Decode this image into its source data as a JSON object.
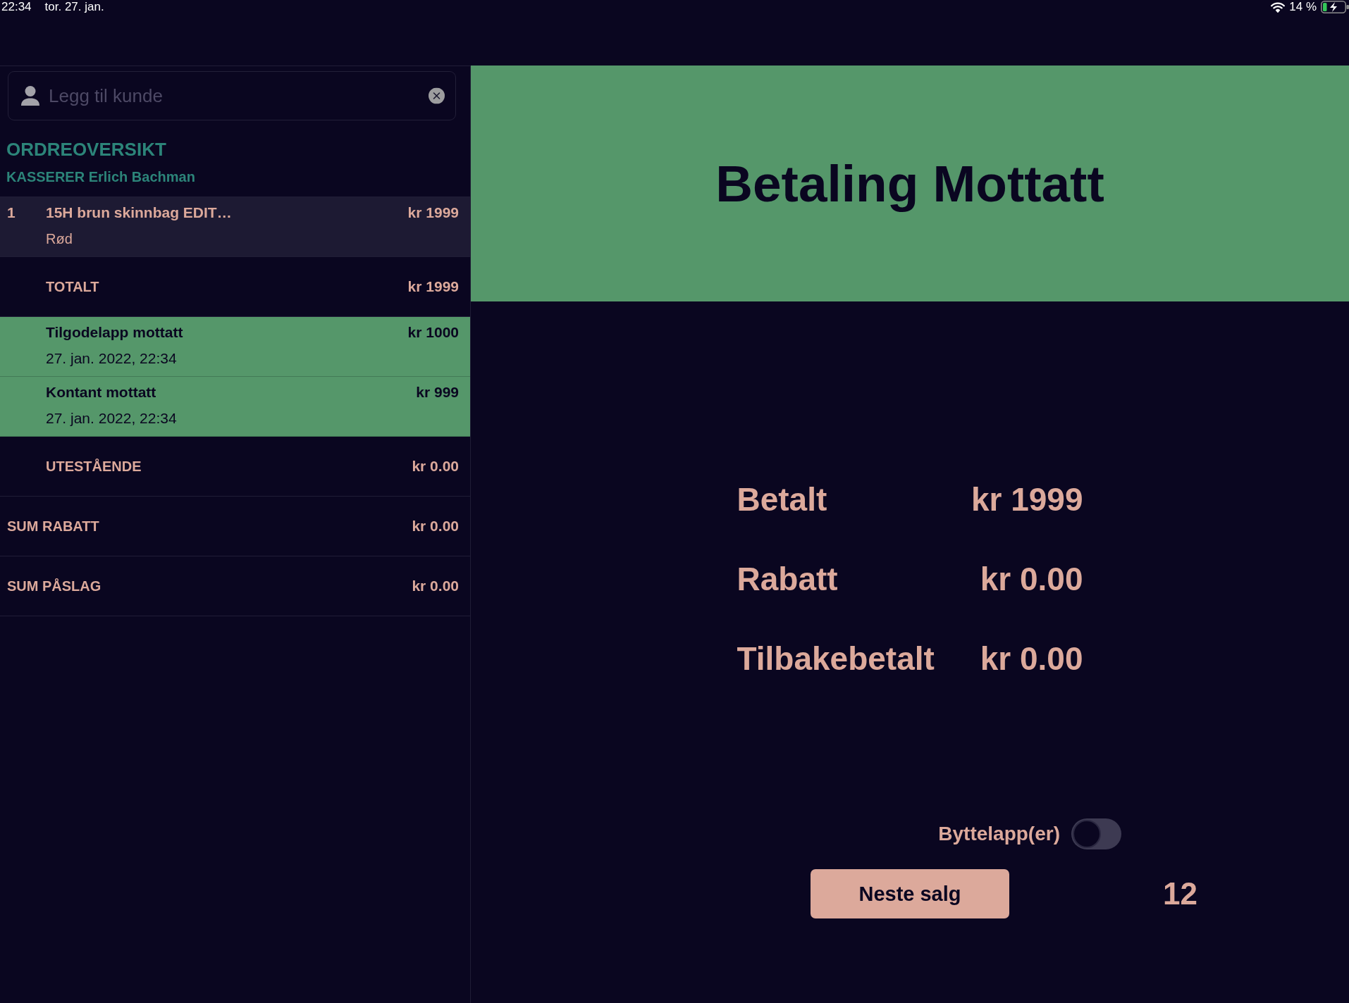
{
  "status_bar": {
    "time": "22:34",
    "date": "tor. 27. jan.",
    "battery": "14 %"
  },
  "customer_field": {
    "placeholder": "Legg til kunde"
  },
  "order_overview": {
    "title": "ORDREOVERSIKT",
    "cashier": "KASSERER Erlich Bachman",
    "rows": [
      {
        "kind": "item",
        "quantity": "1",
        "name": "15H brun skinnbag EDIT…",
        "variant": "Rød",
        "amount": "kr 1999"
      },
      {
        "kind": "total",
        "label": "TOTALT",
        "amount": "kr 1999"
      },
      {
        "kind": "payment",
        "label": "Tilgodelapp mottatt",
        "time": "27. jan. 2022, 22:34",
        "amount": "kr 1000"
      },
      {
        "kind": "payment",
        "label": "Kontant mottatt",
        "time": "27. jan. 2022, 22:34",
        "amount": "kr 999"
      },
      {
        "kind": "total",
        "label": "UTESTÅENDE",
        "amount": "kr 0.00"
      },
      {
        "kind": "summary",
        "label": "SUM RABATT",
        "amount": "kr 0.00"
      },
      {
        "kind": "summary",
        "label": "SUM PÅSLAG",
        "amount": "kr 0.00"
      }
    ]
  },
  "payment_panel": {
    "title": "Betaling Mottatt",
    "summary": [
      {
        "label": "Betalt",
        "value": "kr 1999"
      },
      {
        "label": "Rabatt",
        "value": "kr 0.00"
      },
      {
        "label": "Tilbakebetalt",
        "value": "kr 0.00"
      }
    ],
    "exchange_slip_toggle": {
      "label": "Byttelapp(er)",
      "on": false
    },
    "next_sale_button": "Neste salg",
    "counter": "12"
  }
}
